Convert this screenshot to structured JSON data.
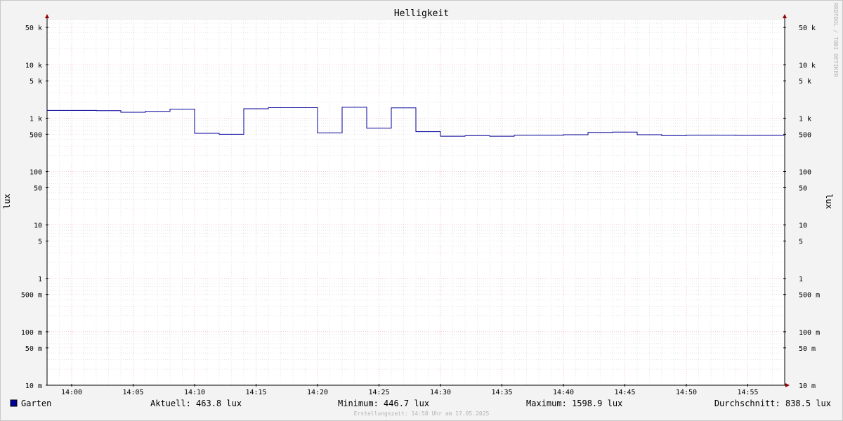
{
  "chart_data": {
    "type": "line",
    "step": true,
    "title": "Helligkeit",
    "ylabel": "lux",
    "ylabel_right": "lux",
    "y_scale": "log",
    "ylim": [
      0.01,
      70000
    ],
    "y_ticks": [
      {
        "value": 50000,
        "label": "50 k"
      },
      {
        "value": 10000,
        "label": "10 k"
      },
      {
        "value": 5000,
        "label": "5 k"
      },
      {
        "value": 1000,
        "label": "1 k"
      },
      {
        "value": 500,
        "label": "500"
      },
      {
        "value": 100,
        "label": "100"
      },
      {
        "value": 50,
        "label": "50"
      },
      {
        "value": 10,
        "label": "10"
      },
      {
        "value": 5,
        "label": "5"
      },
      {
        "value": 1,
        "label": "1"
      },
      {
        "value": 0.5,
        "label": "500 m"
      },
      {
        "value": 0.1,
        "label": "100 m"
      },
      {
        "value": 0.05,
        "label": "50 m"
      },
      {
        "value": 0.01,
        "label": "10 m"
      }
    ],
    "x_ticks": [
      "14:00",
      "14:05",
      "14:10",
      "14:15",
      "14:20",
      "14:25",
      "14:30",
      "14:35",
      "14:40",
      "14:45",
      "14:50",
      "14:55"
    ],
    "xlim": [
      "13:58",
      "14:58"
    ],
    "grid": true,
    "series": [
      {
        "name": "Garten",
        "color": "#000099",
        "x": [
          "13:58",
          "14:00",
          "14:02",
          "14:04",
          "14:06",
          "14:08",
          "14:10",
          "14:12",
          "14:14",
          "14:16",
          "14:18",
          "14:20",
          "14:22",
          "14:24",
          "14:26",
          "14:28",
          "14:30",
          "14:32",
          "14:34",
          "14:36",
          "14:38",
          "14:40",
          "14:42",
          "14:44",
          "14:46",
          "14:48",
          "14:50",
          "14:52",
          "14:54",
          "14:56",
          "14:58"
        ],
        "values": [
          1400,
          1400,
          1380,
          1290,
          1340,
          1480,
          520,
          500,
          1500,
          1570,
          1570,
          530,
          1600,
          650,
          1560,
          560,
          460,
          470,
          460,
          480,
          480,
          490,
          540,
          550,
          490,
          470,
          480,
          480,
          475,
          475,
          475
        ]
      }
    ]
  },
  "watermark": "RRDTOOL / TOBI OETIKER",
  "legend": {
    "series_name": "Garten",
    "current": "Aktuell: 463.8 lux",
    "minimum": "Minimum: 446.7 lux",
    "maximum": "Maximum: 1598.9 lux",
    "average": "Durchschnitt: 838.5 lux"
  },
  "footer": "Erstellungszeit: 14:58 Uhr am 17.05.2025",
  "colors": {
    "background": "#f3f3f3",
    "plot_background": "#ffffff",
    "major_grid": "#f2a6b4",
    "minor_grid": "#d8d8d8",
    "line": "#000099",
    "axis_arrow": "#990000"
  }
}
